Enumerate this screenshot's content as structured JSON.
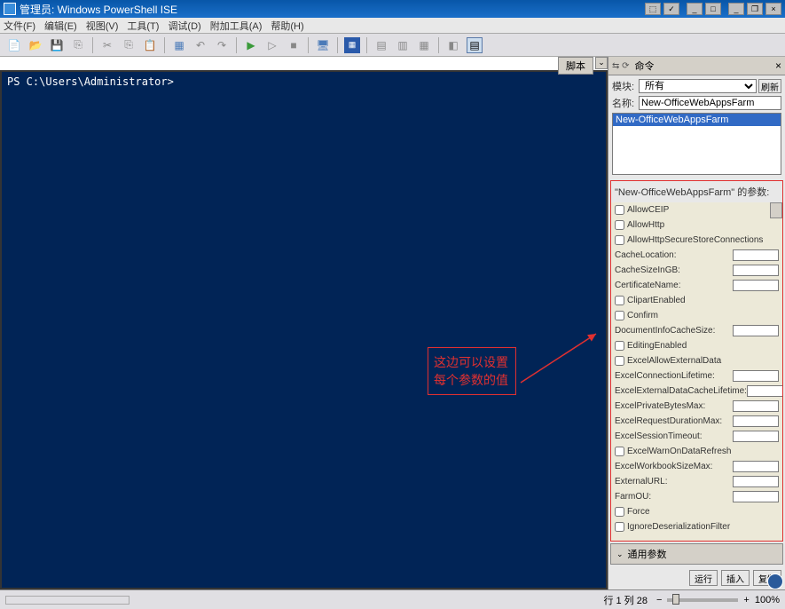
{
  "window": {
    "title": "管理员: Windows PowerShell ISE"
  },
  "menu": {
    "file": "文件(F)",
    "edit": "编辑(E)",
    "view": "视图(V)",
    "tools": "工具(T)",
    "debug": "调试(D)",
    "addons": "附加工具(A)",
    "help": "帮助(H)"
  },
  "script_label": "脚本",
  "console": {
    "prompt": "PS C:\\Users\\Administrator>"
  },
  "annotation": {
    "line1": "这边可以设置",
    "line2": "每个参数的值"
  },
  "cmdpanel": {
    "header": "命令",
    "module_label": "模块:",
    "module_value": "所有",
    "refresh": "刷新",
    "name_label": "名称:",
    "name_value": "New-OfficeWebAppsFarm",
    "selected_item": "New-OfficeWebAppsFarm",
    "params_title": "\"New-OfficeWebAppsFarm\" 的参数:",
    "common_params": "通用参数",
    "btn_run": "运行",
    "btn_insert": "插入",
    "btn_copy": "复制"
  },
  "params": [
    {
      "type": "check",
      "label": "AllowCEIP"
    },
    {
      "type": "check",
      "label": "AllowHttp"
    },
    {
      "type": "check",
      "label": "AllowHttpSecureStoreConnections"
    },
    {
      "type": "text",
      "label": "CacheLocation:"
    },
    {
      "type": "text",
      "label": "CacheSizeInGB:"
    },
    {
      "type": "text",
      "label": "CertificateName:"
    },
    {
      "type": "check",
      "label": "ClipartEnabled"
    },
    {
      "type": "check",
      "label": "Confirm"
    },
    {
      "type": "text",
      "label": "DocumentInfoCacheSize:"
    },
    {
      "type": "check",
      "label": "EditingEnabled"
    },
    {
      "type": "check",
      "label": "ExcelAllowExternalData"
    },
    {
      "type": "text",
      "label": "ExcelConnectionLifetime:"
    },
    {
      "type": "text",
      "label": "ExcelExternalDataCacheLifetime:"
    },
    {
      "type": "text",
      "label": "ExcelPrivateBytesMax:"
    },
    {
      "type": "text",
      "label": "ExcelRequestDurationMax:"
    },
    {
      "type": "text",
      "label": "ExcelSessionTimeout:"
    },
    {
      "type": "check",
      "label": "ExcelWarnOnDataRefresh"
    },
    {
      "type": "text",
      "label": "ExcelWorkbookSizeMax:"
    },
    {
      "type": "text",
      "label": "ExternalURL:"
    },
    {
      "type": "text",
      "label": "FarmOU:"
    },
    {
      "type": "check",
      "label": "Force"
    },
    {
      "type": "check",
      "label": "IgnoreDeserializationFilter"
    }
  ],
  "status": {
    "position": "行 1 列 28",
    "zoom": "100%"
  }
}
